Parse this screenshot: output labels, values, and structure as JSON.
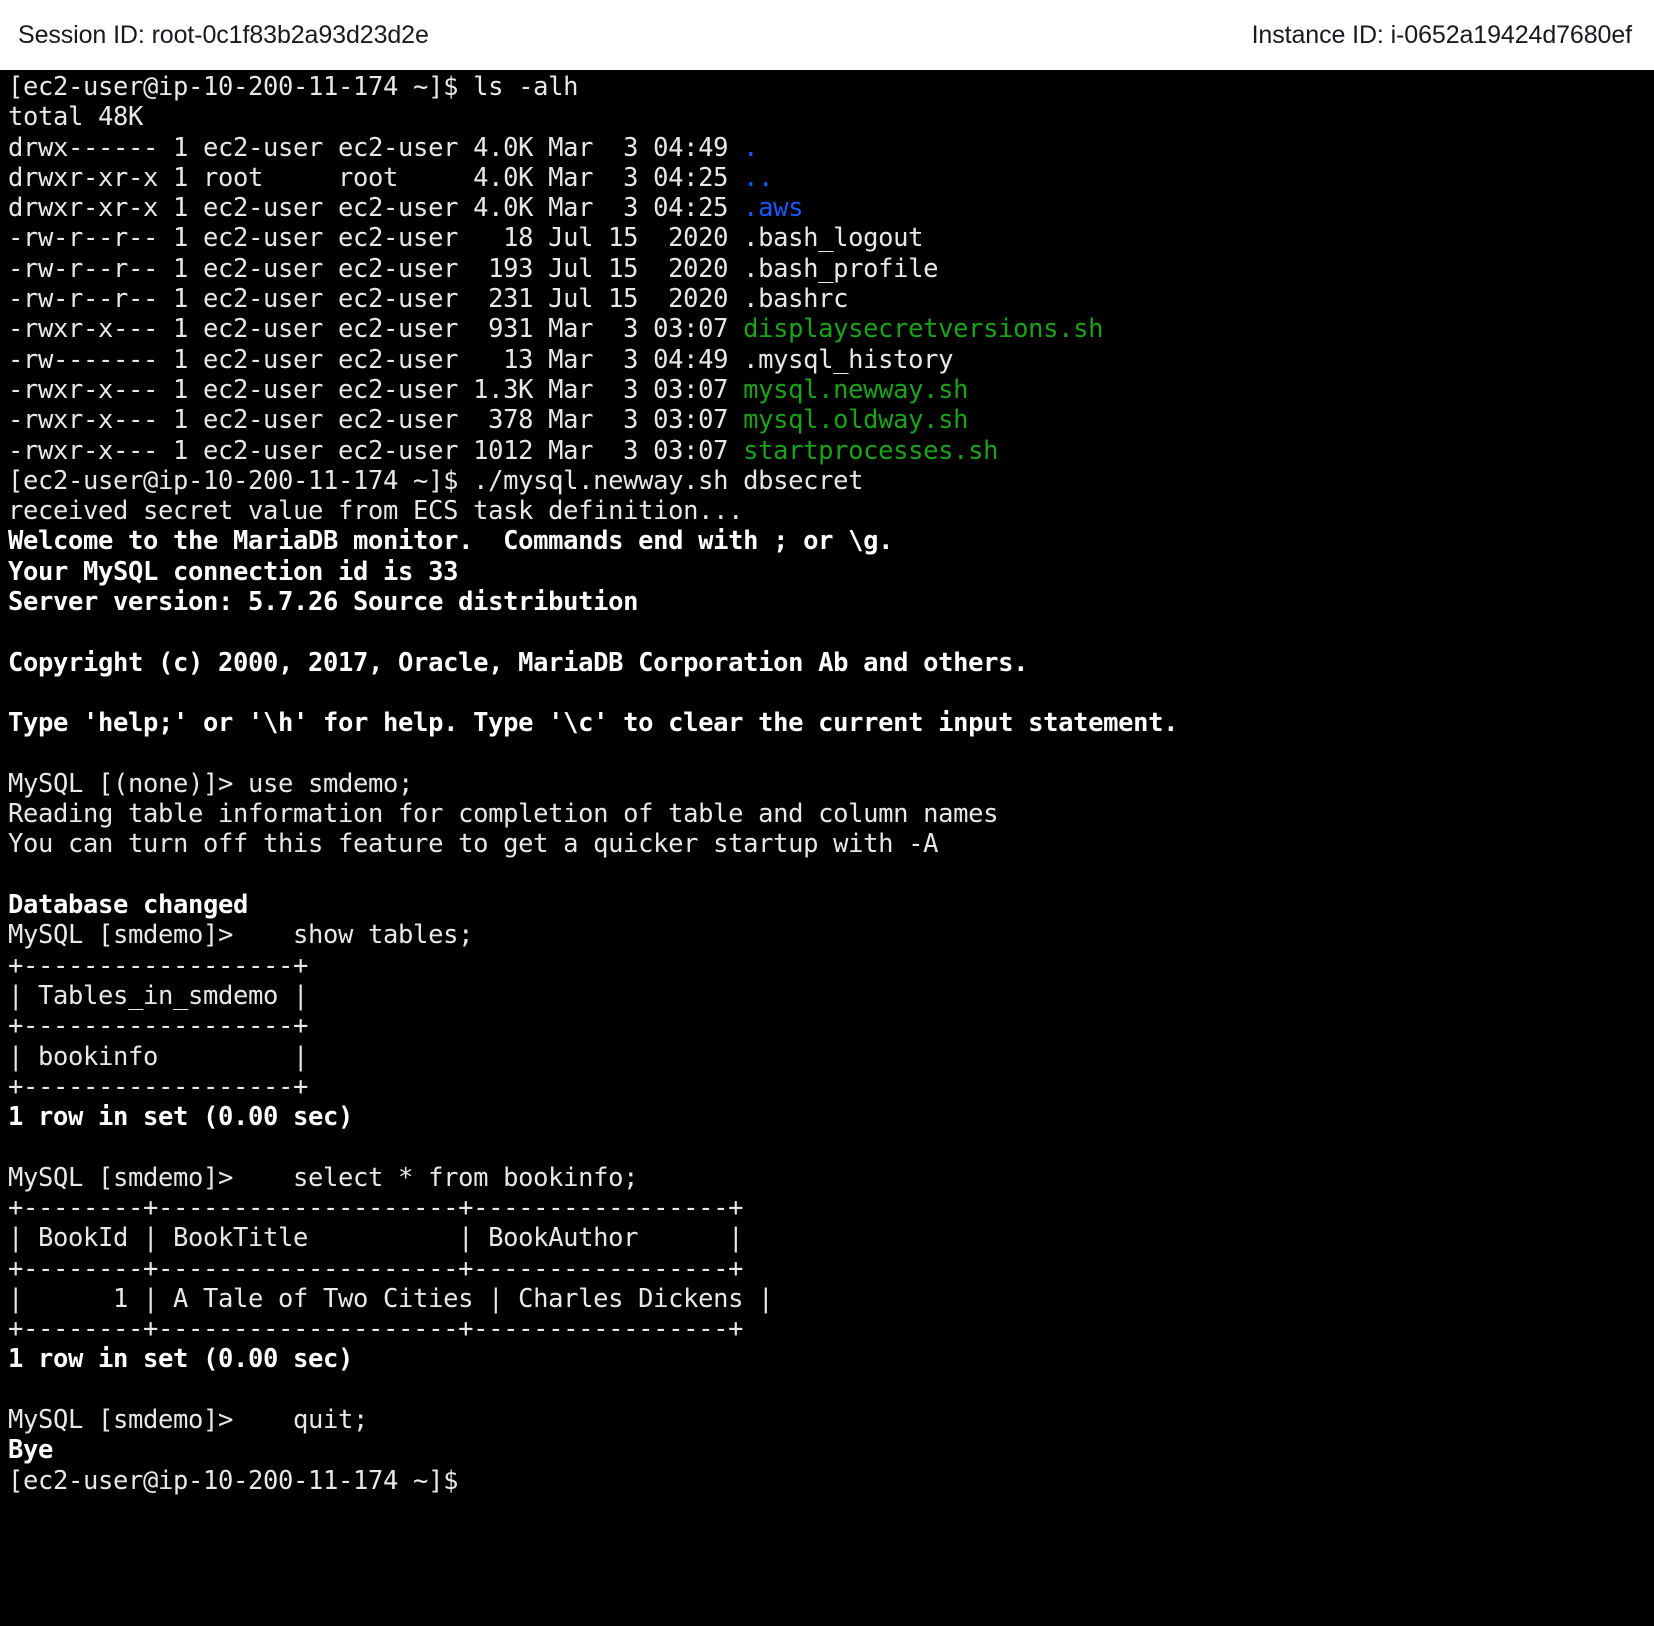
{
  "header": {
    "session_label": "Session ID: root-0c1f83b2a93d23d2e",
    "instance_label": "Instance ID: i-0652a19424d7680ef",
    "background": "#ffffff",
    "text_color": "#16191f"
  },
  "terminal": {
    "background": "#000000",
    "foreground": "#e8e8e8",
    "dir_color": "#1a56ff",
    "exec_color": "#19a319",
    "hostname": "ip-10-200-11-174",
    "user": "ec2-user",
    "prompt": "[ec2-user@ip-10-200-11-174 ~]$",
    "mysql_prompt_none": "MySQL [(none)]>",
    "mysql_prompt_db": "MySQL [smdemo]>",
    "lines": [
      {
        "id": "l0",
        "text": "[ec2-user@ip-10-200-11-174 ~]$ ls -alh",
        "bold": false
      },
      {
        "id": "l1",
        "text": "total 48K",
        "bold": false
      },
      {
        "id": "l2",
        "pre": "drwx------ 1 ec2-user ec2-user 4.0K Mar  3 04:49 ",
        "name": ".",
        "kind": "dir"
      },
      {
        "id": "l3",
        "pre": "drwxr-xr-x 1 root     root     4.0K Mar  3 04:25 ",
        "name": "..",
        "kind": "dir"
      },
      {
        "id": "l4",
        "pre": "drwxr-xr-x 1 ec2-user ec2-user 4.0K Mar  3 04:25 ",
        "name": ".aws",
        "kind": "dir"
      },
      {
        "id": "l5",
        "pre": "-rw-r--r-- 1 ec2-user ec2-user   18 Jul 15  2020 ",
        "name": ".bash_logout",
        "kind": "plain"
      },
      {
        "id": "l6",
        "pre": "-rw-r--r-- 1 ec2-user ec2-user  193 Jul 15  2020 ",
        "name": ".bash_profile",
        "kind": "plain"
      },
      {
        "id": "l7",
        "pre": "-rw-r--r-- 1 ec2-user ec2-user  231 Jul 15  2020 ",
        "name": ".bashrc",
        "kind": "plain"
      },
      {
        "id": "l8",
        "pre": "-rwxr-x--- 1 ec2-user ec2-user  931 Mar  3 03:07 ",
        "name": "displaysecretversions.sh",
        "kind": "exec"
      },
      {
        "id": "l9",
        "pre": "-rw------- 1 ec2-user ec2-user   13 Mar  3 04:49 ",
        "name": ".mysql_history",
        "kind": "plain"
      },
      {
        "id": "l10",
        "pre": "-rwxr-x--- 1 ec2-user ec2-user 1.3K Mar  3 03:07 ",
        "name": "mysql.newway.sh",
        "kind": "exec"
      },
      {
        "id": "l11",
        "pre": "-rwxr-x--- 1 ec2-user ec2-user  378 Mar  3 03:07 ",
        "name": "mysql.oldway.sh",
        "kind": "exec"
      },
      {
        "id": "l12",
        "pre": "-rwxr-x--- 1 ec2-user ec2-user 1012 Mar  3 03:07 ",
        "name": "startprocesses.sh",
        "kind": "exec"
      },
      {
        "id": "l13",
        "text": "[ec2-user@ip-10-200-11-174 ~]$ ./mysql.newway.sh dbsecret",
        "bold": false
      },
      {
        "id": "l14",
        "text": "received secret value from ECS task definition...",
        "bold": false
      },
      {
        "id": "l15",
        "text": "Welcome to the MariaDB monitor.  Commands end with ; or \\g.",
        "bold": true
      },
      {
        "id": "l16",
        "text": "Your MySQL connection id is 33",
        "bold": true
      },
      {
        "id": "l17",
        "text": "Server version: 5.7.26 Source distribution",
        "bold": true
      },
      {
        "id": "l18",
        "text": "",
        "bold": false
      },
      {
        "id": "l19",
        "text": "Copyright (c) 2000, 2017, Oracle, MariaDB Corporation Ab and others.",
        "bold": true
      },
      {
        "id": "l20",
        "text": "",
        "bold": false
      },
      {
        "id": "l21",
        "text": "Type 'help;' or '\\h' for help. Type '\\c' to clear the current input statement.",
        "bold": true
      },
      {
        "id": "l22",
        "text": "",
        "bold": false
      },
      {
        "id": "l23",
        "text": "MySQL [(none)]> use smdemo;",
        "bold": false
      },
      {
        "id": "l24",
        "text": "Reading table information for completion of table and column names",
        "bold": false
      },
      {
        "id": "l25",
        "text": "You can turn off this feature to get a quicker startup with -A",
        "bold": false
      },
      {
        "id": "l26",
        "text": "",
        "bold": false
      },
      {
        "id": "l27",
        "text": "Database changed",
        "bold": true
      },
      {
        "id": "l28",
        "text": "MySQL [smdemo]>    show tables;",
        "bold": false
      },
      {
        "id": "l29",
        "text": "+------------------+",
        "bold": false
      },
      {
        "id": "l30",
        "text": "| Tables_in_smdemo |",
        "bold": false
      },
      {
        "id": "l31",
        "text": "+------------------+",
        "bold": false
      },
      {
        "id": "l32",
        "text": "| bookinfo         |",
        "bold": false
      },
      {
        "id": "l33",
        "text": "+------------------+",
        "bold": false
      },
      {
        "id": "l34",
        "text": "1 row in set (0.00 sec)",
        "bold": true
      },
      {
        "id": "l35",
        "text": "",
        "bold": false
      },
      {
        "id": "l36",
        "text": "MySQL [smdemo]>    select * from bookinfo;",
        "bold": false
      },
      {
        "id": "l37",
        "text": "+--------+--------------------+-----------------+",
        "bold": false
      },
      {
        "id": "l38",
        "text": "| BookId | BookTitle          | BookAuthor      |",
        "bold": false
      },
      {
        "id": "l39",
        "text": "+--------+--------------------+-----------------+",
        "bold": false
      },
      {
        "id": "l40",
        "text": "|      1 | A Tale of Two Cities | Charles Dickens |",
        "bold": false
      },
      {
        "id": "l41",
        "text": "+--------+--------------------+-----------------+",
        "bold": false
      },
      {
        "id": "l42",
        "text": "1 row in set (0.00 sec)",
        "bold": true
      },
      {
        "id": "l43",
        "text": "",
        "bold": false
      },
      {
        "id": "l44",
        "text": "MySQL [smdemo]>    quit;",
        "bold": false
      },
      {
        "id": "l45",
        "text": "Bye",
        "bold": true
      },
      {
        "id": "l46",
        "text": "[ec2-user@ip-10-200-11-174 ~]$",
        "bold": false
      }
    ],
    "tables": [
      {
        "name": "show-tables-result",
        "columns": [
          "Tables_in_smdemo"
        ],
        "rows": [
          [
            "bookinfo"
          ]
        ],
        "footer": "1 row in set (0.00 sec)"
      },
      {
        "name": "bookinfo-select-result",
        "columns": [
          "BookId",
          "BookTitle",
          "BookAuthor"
        ],
        "rows": [
          [
            "1",
            "A Tale of Two Cities",
            "Charles Dickens"
          ]
        ],
        "footer": "1 row in set (0.00 sec)"
      }
    ],
    "commands": [
      "ls -alh",
      "./mysql.newway.sh dbsecret",
      "use smdemo;",
      "show tables;",
      "select * from bookinfo;",
      "quit;"
    ],
    "file_listing": {
      "total": "total 48K",
      "entries": [
        {
          "perms": "drwx------",
          "links": "1",
          "owner": "ec2-user",
          "group": "ec2-user",
          "size": "4.0K",
          "month": "Mar",
          "day": "3",
          "time": "04:49",
          "name": ".",
          "kind": "dir"
        },
        {
          "perms": "drwxr-xr-x",
          "links": "1",
          "owner": "root",
          "group": "root",
          "size": "4.0K",
          "month": "Mar",
          "day": "3",
          "time": "04:25",
          "name": "..",
          "kind": "dir"
        },
        {
          "perms": "drwxr-xr-x",
          "links": "1",
          "owner": "ec2-user",
          "group": "ec2-user",
          "size": "4.0K",
          "month": "Mar",
          "day": "3",
          "time": "04:25",
          "name": ".aws",
          "kind": "dir"
        },
        {
          "perms": "-rw-r--r--",
          "links": "1",
          "owner": "ec2-user",
          "group": "ec2-user",
          "size": "18",
          "month": "Jul",
          "day": "15",
          "time": "2020",
          "name": ".bash_logout",
          "kind": "plain"
        },
        {
          "perms": "-rw-r--r--",
          "links": "1",
          "owner": "ec2-user",
          "group": "ec2-user",
          "size": "193",
          "month": "Jul",
          "day": "15",
          "time": "2020",
          "name": ".bash_profile",
          "kind": "plain"
        },
        {
          "perms": "-rw-r--r--",
          "links": "1",
          "owner": "ec2-user",
          "group": "ec2-user",
          "size": "231",
          "month": "Jul",
          "day": "15",
          "time": "2020",
          "name": ".bashrc",
          "kind": "plain"
        },
        {
          "perms": "-rwxr-x---",
          "links": "1",
          "owner": "ec2-user",
          "group": "ec2-user",
          "size": "931",
          "month": "Mar",
          "day": "3",
          "time": "03:07",
          "name": "displaysecretversions.sh",
          "kind": "exec"
        },
        {
          "perms": "-rw-------",
          "links": "1",
          "owner": "ec2-user",
          "group": "ec2-user",
          "size": "13",
          "month": "Mar",
          "day": "3",
          "time": "04:49",
          "name": ".mysql_history",
          "kind": "plain"
        },
        {
          "perms": "-rwxr-x---",
          "links": "1",
          "owner": "ec2-user",
          "group": "ec2-user",
          "size": "1.3K",
          "month": "Mar",
          "day": "3",
          "time": "03:07",
          "name": "mysql.newway.sh",
          "kind": "exec"
        },
        {
          "perms": "-rwxr-x---",
          "links": "1",
          "owner": "ec2-user",
          "group": "ec2-user",
          "size": "378",
          "month": "Mar",
          "day": "3",
          "time": "03:07",
          "name": "mysql.oldway.sh",
          "kind": "exec"
        },
        {
          "perms": "-rwxr-x---",
          "links": "1",
          "owner": "ec2-user",
          "group": "ec2-user",
          "size": "1012",
          "month": "Mar",
          "day": "3",
          "time": "03:07",
          "name": "startprocesses.sh",
          "kind": "exec"
        }
      ]
    }
  }
}
